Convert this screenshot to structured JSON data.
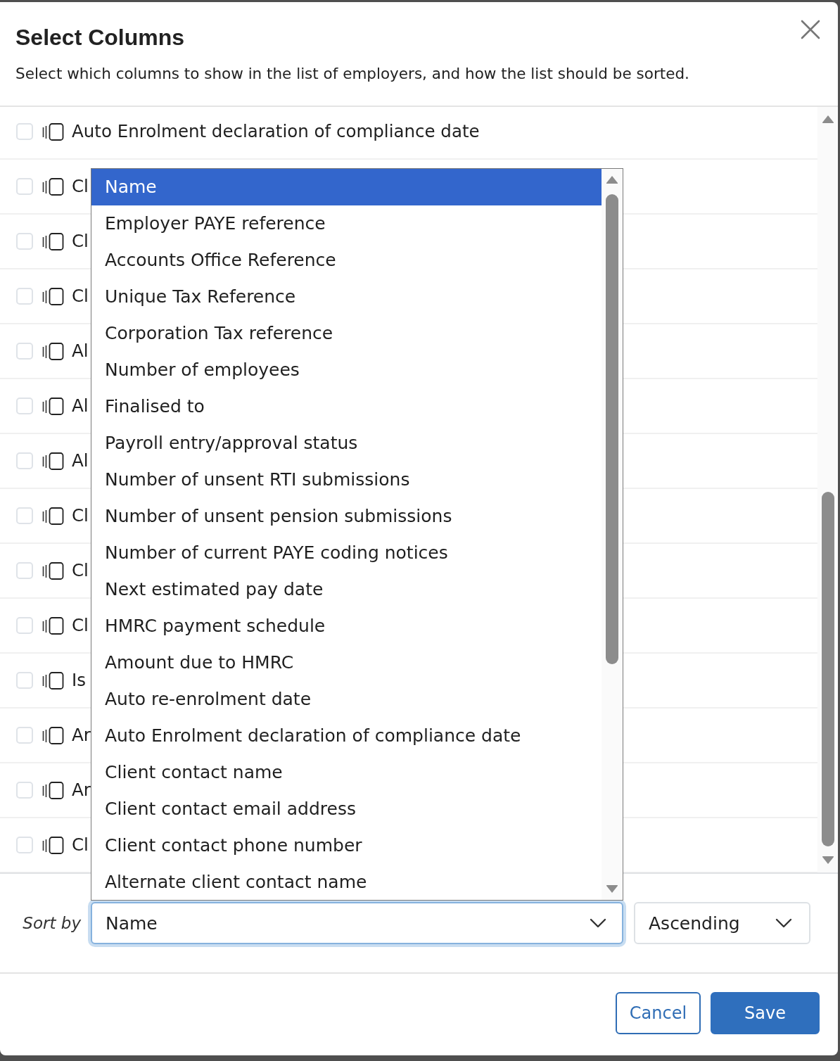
{
  "dialog": {
    "title": "Select Columns",
    "description": "Select which columns to show in the list of employers, and how the list should be sorted."
  },
  "columns": [
    {
      "label": "Auto Enrolment declaration of compliance date",
      "checked": false
    },
    {
      "label": "Cl",
      "checked": false
    },
    {
      "label": "Cl",
      "checked": false
    },
    {
      "label": "Cl",
      "checked": false
    },
    {
      "label": "Al",
      "checked": false
    },
    {
      "label": "Al",
      "checked": false
    },
    {
      "label": "Al",
      "checked": false
    },
    {
      "label": "Cl",
      "checked": false
    },
    {
      "label": "Cl",
      "checked": false
    },
    {
      "label": "Cl",
      "checked": false
    },
    {
      "label": "Is",
      "checked": false
    },
    {
      "label": "Ar",
      "checked": false
    },
    {
      "label": "Ar",
      "checked": false
    },
    {
      "label": "Cl",
      "checked": false
    }
  ],
  "sort": {
    "label": "Sort by",
    "field": {
      "value": "Name",
      "open": true,
      "options": [
        {
          "label": "Name",
          "selected": true
        },
        {
          "label": "Employer PAYE reference",
          "selected": false
        },
        {
          "label": "Accounts Office Reference",
          "selected": false
        },
        {
          "label": "Unique Tax Reference",
          "selected": false
        },
        {
          "label": "Corporation Tax reference",
          "selected": false
        },
        {
          "label": "Number of employees",
          "selected": false
        },
        {
          "label": "Finalised to",
          "selected": false
        },
        {
          "label": "Payroll entry/approval status",
          "selected": false
        },
        {
          "label": "Number of unsent RTI submissions",
          "selected": false
        },
        {
          "label": "Number of unsent pension submissions",
          "selected": false
        },
        {
          "label": "Number of current PAYE coding notices",
          "selected": false
        },
        {
          "label": "Next estimated pay date",
          "selected": false
        },
        {
          "label": "HMRC payment schedule",
          "selected": false
        },
        {
          "label": "Amount due to HMRC",
          "selected": false
        },
        {
          "label": "Auto re-enrolment date",
          "selected": false
        },
        {
          "label": "Auto Enrolment declaration of compliance date",
          "selected": false
        },
        {
          "label": "Client contact name",
          "selected": false
        },
        {
          "label": "Client contact email address",
          "selected": false
        },
        {
          "label": "Client contact phone number",
          "selected": false
        },
        {
          "label": "Alternate client contact name",
          "selected": false
        }
      ]
    },
    "order": {
      "value": "Ascending"
    }
  },
  "buttons": [
    {
      "label": "Cancel",
      "kind": "secondary"
    },
    {
      "label": "Save",
      "kind": "primary"
    }
  ]
}
